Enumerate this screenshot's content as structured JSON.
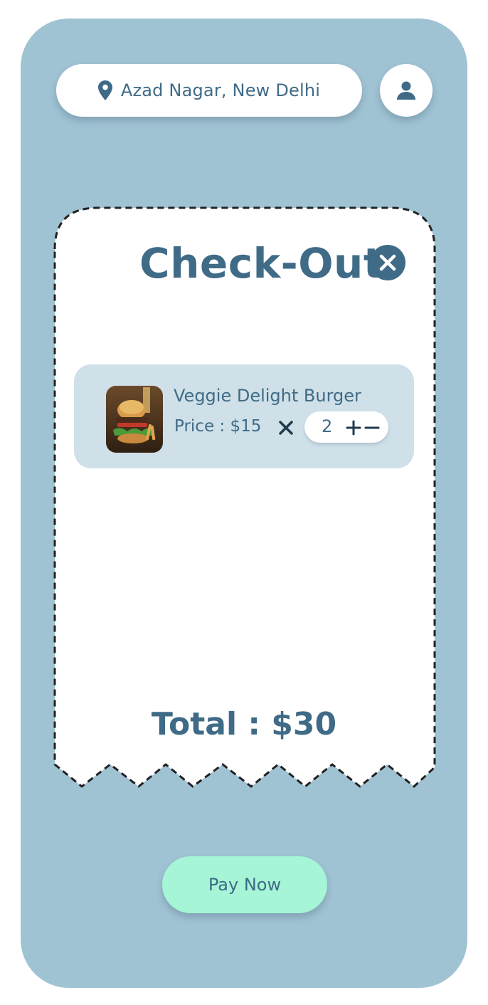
{
  "header": {
    "location_text": "Azad Nagar, New Delhi",
    "location_icon": "map-pin-icon",
    "profile_icon": "user-icon"
  },
  "checkout": {
    "title": "Check-Out",
    "close_icon": "close-icon",
    "items": [
      {
        "name": "Veggie Delight Burger",
        "price_text": "Price : $15",
        "quantity": "2",
        "thumb_icon": "burger-photo"
      }
    ],
    "total_text": "Total : $30"
  },
  "actions": {
    "pay_label": "Pay Now"
  },
  "colors": {
    "background": "#a0c3d4",
    "accent": "#3f6b87",
    "card": "#cfe0e8",
    "pay_button": "#a5f5d6"
  }
}
